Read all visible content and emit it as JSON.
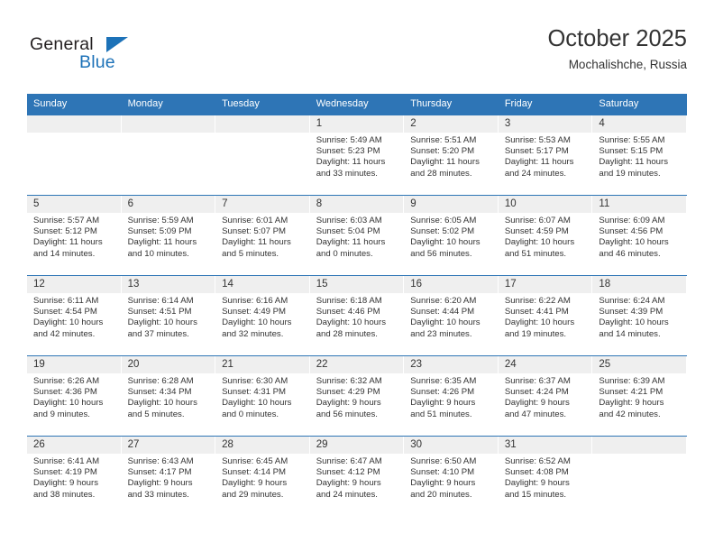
{
  "brand": {
    "name_top": "General",
    "name_bottom": "Blue",
    "accent_color": "#1d72b8",
    "triangle_icon": "brand-triangle-icon"
  },
  "header": {
    "title": "October 2025",
    "subtitle": "Mochalishche, Russia"
  },
  "theme": {
    "header_blue": "#2e75b6",
    "band_gray": "#efefef",
    "text": "#333333"
  },
  "calendar": {
    "weekday_headers": [
      "Sunday",
      "Monday",
      "Tuesday",
      "Wednesday",
      "Thursday",
      "Friday",
      "Saturday"
    ],
    "weeks": [
      [
        {
          "day": "",
          "empty": true
        },
        {
          "day": "",
          "empty": true
        },
        {
          "day": "",
          "empty": true
        },
        {
          "day": "1",
          "sunrise": "Sunrise: 5:49 AM",
          "sunset": "Sunset: 5:23 PM",
          "daylight_1": "Daylight: 11 hours",
          "daylight_2": "and 33 minutes."
        },
        {
          "day": "2",
          "sunrise": "Sunrise: 5:51 AM",
          "sunset": "Sunset: 5:20 PM",
          "daylight_1": "Daylight: 11 hours",
          "daylight_2": "and 28 minutes."
        },
        {
          "day": "3",
          "sunrise": "Sunrise: 5:53 AM",
          "sunset": "Sunset: 5:17 PM",
          "daylight_1": "Daylight: 11 hours",
          "daylight_2": "and 24 minutes."
        },
        {
          "day": "4",
          "sunrise": "Sunrise: 5:55 AM",
          "sunset": "Sunset: 5:15 PM",
          "daylight_1": "Daylight: 11 hours",
          "daylight_2": "and 19 minutes."
        }
      ],
      [
        {
          "day": "5",
          "sunrise": "Sunrise: 5:57 AM",
          "sunset": "Sunset: 5:12 PM",
          "daylight_1": "Daylight: 11 hours",
          "daylight_2": "and 14 minutes."
        },
        {
          "day": "6",
          "sunrise": "Sunrise: 5:59 AM",
          "sunset": "Sunset: 5:09 PM",
          "daylight_1": "Daylight: 11 hours",
          "daylight_2": "and 10 minutes."
        },
        {
          "day": "7",
          "sunrise": "Sunrise: 6:01 AM",
          "sunset": "Sunset: 5:07 PM",
          "daylight_1": "Daylight: 11 hours",
          "daylight_2": "and 5 minutes."
        },
        {
          "day": "8",
          "sunrise": "Sunrise: 6:03 AM",
          "sunset": "Sunset: 5:04 PM",
          "daylight_1": "Daylight: 11 hours",
          "daylight_2": "and 0 minutes."
        },
        {
          "day": "9",
          "sunrise": "Sunrise: 6:05 AM",
          "sunset": "Sunset: 5:02 PM",
          "daylight_1": "Daylight: 10 hours",
          "daylight_2": "and 56 minutes."
        },
        {
          "day": "10",
          "sunrise": "Sunrise: 6:07 AM",
          "sunset": "Sunset: 4:59 PM",
          "daylight_1": "Daylight: 10 hours",
          "daylight_2": "and 51 minutes."
        },
        {
          "day": "11",
          "sunrise": "Sunrise: 6:09 AM",
          "sunset": "Sunset: 4:56 PM",
          "daylight_1": "Daylight: 10 hours",
          "daylight_2": "and 46 minutes."
        }
      ],
      [
        {
          "day": "12",
          "sunrise": "Sunrise: 6:11 AM",
          "sunset": "Sunset: 4:54 PM",
          "daylight_1": "Daylight: 10 hours",
          "daylight_2": "and 42 minutes."
        },
        {
          "day": "13",
          "sunrise": "Sunrise: 6:14 AM",
          "sunset": "Sunset: 4:51 PM",
          "daylight_1": "Daylight: 10 hours",
          "daylight_2": "and 37 minutes."
        },
        {
          "day": "14",
          "sunrise": "Sunrise: 6:16 AM",
          "sunset": "Sunset: 4:49 PM",
          "daylight_1": "Daylight: 10 hours",
          "daylight_2": "and 32 minutes."
        },
        {
          "day": "15",
          "sunrise": "Sunrise: 6:18 AM",
          "sunset": "Sunset: 4:46 PM",
          "daylight_1": "Daylight: 10 hours",
          "daylight_2": "and 28 minutes."
        },
        {
          "day": "16",
          "sunrise": "Sunrise: 6:20 AM",
          "sunset": "Sunset: 4:44 PM",
          "daylight_1": "Daylight: 10 hours",
          "daylight_2": "and 23 minutes."
        },
        {
          "day": "17",
          "sunrise": "Sunrise: 6:22 AM",
          "sunset": "Sunset: 4:41 PM",
          "daylight_1": "Daylight: 10 hours",
          "daylight_2": "and 19 minutes."
        },
        {
          "day": "18",
          "sunrise": "Sunrise: 6:24 AM",
          "sunset": "Sunset: 4:39 PM",
          "daylight_1": "Daylight: 10 hours",
          "daylight_2": "and 14 minutes."
        }
      ],
      [
        {
          "day": "19",
          "sunrise": "Sunrise: 6:26 AM",
          "sunset": "Sunset: 4:36 PM",
          "daylight_1": "Daylight: 10 hours",
          "daylight_2": "and 9 minutes."
        },
        {
          "day": "20",
          "sunrise": "Sunrise: 6:28 AM",
          "sunset": "Sunset: 4:34 PM",
          "daylight_1": "Daylight: 10 hours",
          "daylight_2": "and 5 minutes."
        },
        {
          "day": "21",
          "sunrise": "Sunrise: 6:30 AM",
          "sunset": "Sunset: 4:31 PM",
          "daylight_1": "Daylight: 10 hours",
          "daylight_2": "and 0 minutes."
        },
        {
          "day": "22",
          "sunrise": "Sunrise: 6:32 AM",
          "sunset": "Sunset: 4:29 PM",
          "daylight_1": "Daylight: 9 hours",
          "daylight_2": "and 56 minutes."
        },
        {
          "day": "23",
          "sunrise": "Sunrise: 6:35 AM",
          "sunset": "Sunset: 4:26 PM",
          "daylight_1": "Daylight: 9 hours",
          "daylight_2": "and 51 minutes."
        },
        {
          "day": "24",
          "sunrise": "Sunrise: 6:37 AM",
          "sunset": "Sunset: 4:24 PM",
          "daylight_1": "Daylight: 9 hours",
          "daylight_2": "and 47 minutes."
        },
        {
          "day": "25",
          "sunrise": "Sunrise: 6:39 AM",
          "sunset": "Sunset: 4:21 PM",
          "daylight_1": "Daylight: 9 hours",
          "daylight_2": "and 42 minutes."
        }
      ],
      [
        {
          "day": "26",
          "sunrise": "Sunrise: 6:41 AM",
          "sunset": "Sunset: 4:19 PM",
          "daylight_1": "Daylight: 9 hours",
          "daylight_2": "and 38 minutes."
        },
        {
          "day": "27",
          "sunrise": "Sunrise: 6:43 AM",
          "sunset": "Sunset: 4:17 PM",
          "daylight_1": "Daylight: 9 hours",
          "daylight_2": "and 33 minutes."
        },
        {
          "day": "28",
          "sunrise": "Sunrise: 6:45 AM",
          "sunset": "Sunset: 4:14 PM",
          "daylight_1": "Daylight: 9 hours",
          "daylight_2": "and 29 minutes."
        },
        {
          "day": "29",
          "sunrise": "Sunrise: 6:47 AM",
          "sunset": "Sunset: 4:12 PM",
          "daylight_1": "Daylight: 9 hours",
          "daylight_2": "and 24 minutes."
        },
        {
          "day": "30",
          "sunrise": "Sunrise: 6:50 AM",
          "sunset": "Sunset: 4:10 PM",
          "daylight_1": "Daylight: 9 hours",
          "daylight_2": "and 20 minutes."
        },
        {
          "day": "31",
          "sunrise": "Sunrise: 6:52 AM",
          "sunset": "Sunset: 4:08 PM",
          "daylight_1": "Daylight: 9 hours",
          "daylight_2": "and 15 minutes."
        },
        {
          "day": "",
          "empty": true
        }
      ]
    ]
  }
}
